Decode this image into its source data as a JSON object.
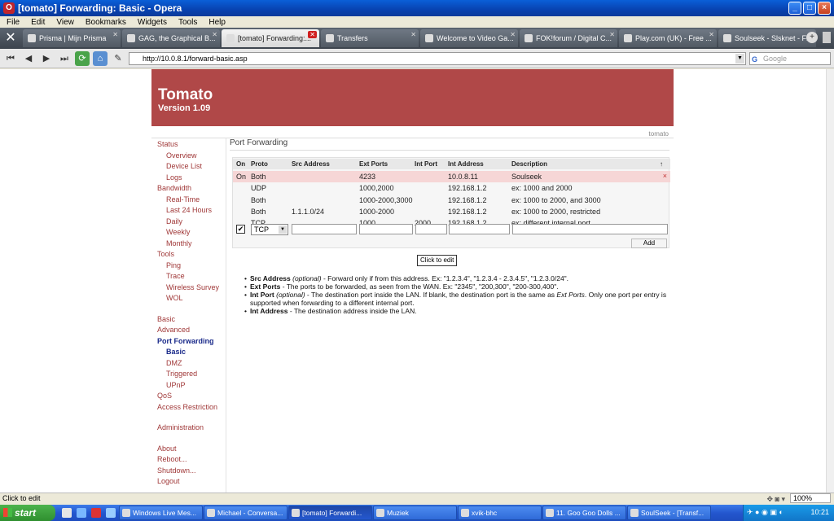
{
  "window": {
    "title": "[tomato] Forwarding: Basic - Opera"
  },
  "menu": [
    "File",
    "Edit",
    "View",
    "Bookmarks",
    "Widgets",
    "Tools",
    "Help"
  ],
  "tabs": [
    {
      "label": "Prisma | Mijn Prisma"
    },
    {
      "label": "GAG, the Graphical B..."
    },
    {
      "label": "[tomato] Forwarding:..."
    },
    {
      "label": "Transfers"
    },
    {
      "label": "Welcome to Video Ga..."
    },
    {
      "label": "FOK!forum / Digital C..."
    },
    {
      "label": "Play.com (UK) - Free ..."
    },
    {
      "label": "Soulseek - Slsknet - Fi..."
    }
  ],
  "address": {
    "url": "http://10.0.8.1/forward-basic.asp",
    "search_placeholder": "Google",
    "search_icon": "G"
  },
  "page": {
    "brand": "Tomato",
    "version": "Version 1.09",
    "corner_label": "tomato",
    "section_title": "Port Forwarding"
  },
  "sidebar": [
    {
      "label": "Status",
      "level": 0
    },
    {
      "label": "Overview",
      "level": 1
    },
    {
      "label": "Device List",
      "level": 1
    },
    {
      "label": "Logs",
      "level": 1
    },
    {
      "label": "Bandwidth",
      "level": 0
    },
    {
      "label": "Real-Time",
      "level": 1
    },
    {
      "label": "Last 24 Hours",
      "level": 1
    },
    {
      "label": "Daily",
      "level": 1
    },
    {
      "label": "Weekly",
      "level": 1
    },
    {
      "label": "Monthly",
      "level": 1
    },
    {
      "label": "Tools",
      "level": 0
    },
    {
      "label": "Ping",
      "level": 1
    },
    {
      "label": "Trace",
      "level": 1
    },
    {
      "label": "Wireless Survey",
      "level": 1
    },
    {
      "label": "WOL",
      "level": 1
    },
    {
      "label": "Basic",
      "level": 0
    },
    {
      "label": "Advanced",
      "level": 0
    },
    {
      "label": "Port Forwarding",
      "level": 0
    },
    {
      "label": "Basic",
      "level": 1
    },
    {
      "label": "DMZ",
      "level": 1
    },
    {
      "label": "Triggered",
      "level": 1
    },
    {
      "label": "UPnP",
      "level": 1
    },
    {
      "label": "QoS",
      "level": 0
    },
    {
      "label": "Access Restriction",
      "level": 0
    },
    {
      "label": "Administration",
      "level": 0
    },
    {
      "label": "About",
      "level": 0
    },
    {
      "label": "Reboot...",
      "level": 0
    },
    {
      "label": "Shutdown...",
      "level": 0
    },
    {
      "label": "Logout",
      "level": 0
    }
  ],
  "table": {
    "headers": [
      "On",
      "Proto",
      "Src Address",
      "Ext Ports",
      "Int Port",
      "Int Address",
      "Description"
    ],
    "sort_icon": "↑",
    "rows": [
      [
        "On",
        "Both",
        "",
        "4233",
        "",
        "10.0.8.11",
        "Soulseek"
      ],
      [
        "",
        "UDP",
        "",
        "1000,2000",
        "",
        "192.168.1.2",
        "ex: 1000 and 2000"
      ],
      [
        "",
        "Both",
        "",
        "1000-2000,3000",
        "",
        "192.168.1.2",
        "ex: 1000 to 2000, and 3000"
      ],
      [
        "",
        "Both",
        "1.1.1.0/24",
        "1000-2000",
        "",
        "192.168.1.2",
        "ex: 1000 to 2000, restricted"
      ],
      [
        "",
        "TCP",
        "",
        "1000",
        "2000",
        "192.168.1.2",
        "ex: different internal port"
      ]
    ],
    "new_proto": "TCP",
    "add_label": "Add",
    "tooltip": "Click to edit"
  },
  "help": [
    {
      "term": "Src Address",
      "opt": " (optional)",
      "text": " - Forward only if from this address. Ex: \"1.2.3.4\", \"1.2.3.4 - 2.3.4.5\", \"1.2.3.0/24\"."
    },
    {
      "term": "Ext Ports",
      "opt": "",
      "text": " - The ports to be forwarded, as seen from the WAN. Ex: \"2345\", \"200,300\", \"200-300,400\"."
    },
    {
      "term": "Int Port",
      "opt": " (optional)",
      "text": " - The destination port inside the LAN. If blank, the destination port is the same as ",
      "em": "Ext Ports",
      "tail": ". Only one port per entry is supported when forwarding to a different internal port."
    },
    {
      "term": "Int Address",
      "opt": "",
      "text": " - The destination address inside the LAN."
    }
  ],
  "statusbar": {
    "text": "Click to edit",
    "zoom": "100%"
  },
  "taskbar": {
    "start": "start",
    "tasks": [
      "Windows Live Mes...",
      "Michael - Conversa...",
      "[tomato] Forwardi...",
      "Muziek",
      "xvik-bhc",
      "11. Goo Goo Dolls ...",
      "SoulSeek - [Transf..."
    ],
    "clock": "10:21"
  }
}
